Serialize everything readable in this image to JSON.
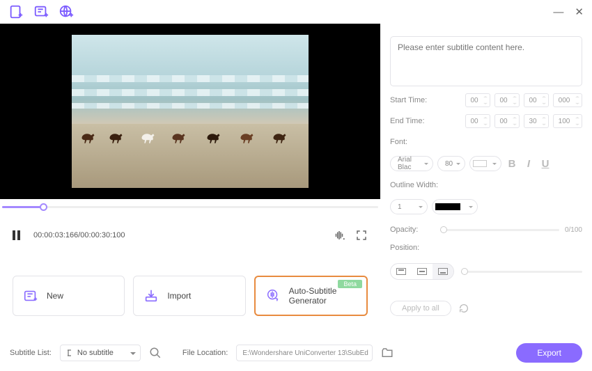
{
  "titlebar": {
    "minimize": "—",
    "close": "✕"
  },
  "player": {
    "time_display": "00:00:03:166/00:00:30:100"
  },
  "cards": {
    "new": "New",
    "import": "Import",
    "auto": "Auto-Subtitle Generator",
    "beta": "Beta"
  },
  "subtitle": {
    "placeholder": "Please enter subtitle content here."
  },
  "time": {
    "start_label": "Start Time:",
    "end_label": "End Time:",
    "start": [
      "00",
      "00",
      "00",
      "000"
    ],
    "end": [
      "00",
      "00",
      "30",
      "100"
    ]
  },
  "font": {
    "label": "Font:",
    "family": "Arial Blac",
    "size": "80"
  },
  "outline": {
    "label": "Outline Width:",
    "width": "1"
  },
  "opacity": {
    "label": "Opacity:",
    "display": "0/100"
  },
  "position": {
    "label": "Position:"
  },
  "apply": {
    "label": "Apply to all"
  },
  "footer": {
    "list_label": "Subtitle List:",
    "list_value": "No subtitle",
    "loc_label": "File Location:",
    "loc_value": "E:\\Wondershare UniConverter 13\\SubEd",
    "export": "Export"
  }
}
